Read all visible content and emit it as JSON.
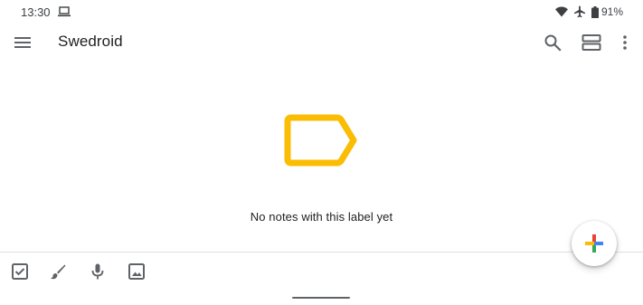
{
  "status_bar": {
    "time": "13:30",
    "battery": "91%",
    "icons": [
      "laptop-icon",
      "wifi-icon",
      "airplane-icon",
      "battery-icon"
    ]
  },
  "app_bar": {
    "title": "Swedroid",
    "icons": [
      "menu-icon",
      "search-icon",
      "layout-toggle-icon",
      "more-vert-icon"
    ]
  },
  "empty_state": {
    "message": "No notes with this label yet",
    "icon": "label-outline-icon"
  },
  "bottom_toolbar": {
    "tools": [
      "checkbox-icon",
      "brush-icon",
      "mic-icon",
      "image-icon"
    ]
  },
  "fab": {
    "icon": "plus-icon"
  },
  "colors": {
    "label_yellow": "#fbbc04",
    "icon_gray": "#5f6368",
    "plus_blue": "#4285f4",
    "plus_red": "#ea4335",
    "plus_yellow": "#fbbc04",
    "plus_green": "#34a853"
  }
}
